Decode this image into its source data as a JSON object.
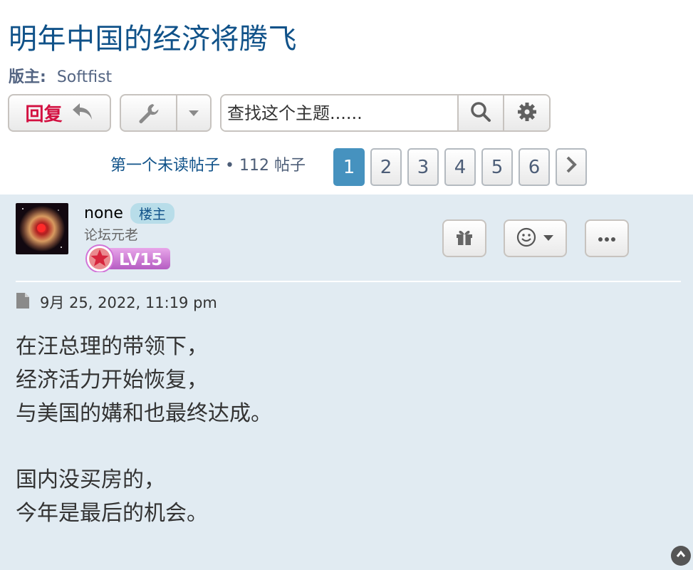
{
  "topic": {
    "title": "明年中国的经济将腾飞",
    "moderator_label": "版主:",
    "moderator_name": "Softfist"
  },
  "toolbar": {
    "reply_label": "回复",
    "search_placeholder": "查找这个主题......"
  },
  "pagination": {
    "first_unread": "第一个未读帖子",
    "separator": "•",
    "count": "112 帖子",
    "pages": [
      "1",
      "2",
      "3",
      "4",
      "5",
      "6"
    ],
    "active_page": "1"
  },
  "post": {
    "author": "none",
    "op_badge": "楼主",
    "rank": "论坛元老",
    "level": "LV15",
    "date": "9月 25, 2022, 11:19 pm",
    "lines": [
      "在汪总理的带领下，",
      "经济活力开始恢复，",
      "与美国的媾和也最终达成。",
      "",
      "国内没买房的，",
      "今年是最后的机会。"
    ]
  },
  "icons": {
    "reply": "reply-arrow-icon",
    "tools": "wrench-icon",
    "search": "search-icon",
    "settings": "gear-icon",
    "next": "chevron-right-icon",
    "gift": "gift-icon",
    "reaction": "smiley-icon",
    "more": "ellipsis-icon",
    "file": "file-icon",
    "top": "scroll-top-icon"
  },
  "colors": {
    "title": "#105289",
    "reply_text": "#d31141",
    "active_page": "#4692bf",
    "post_bg": "#e1ebf2"
  }
}
